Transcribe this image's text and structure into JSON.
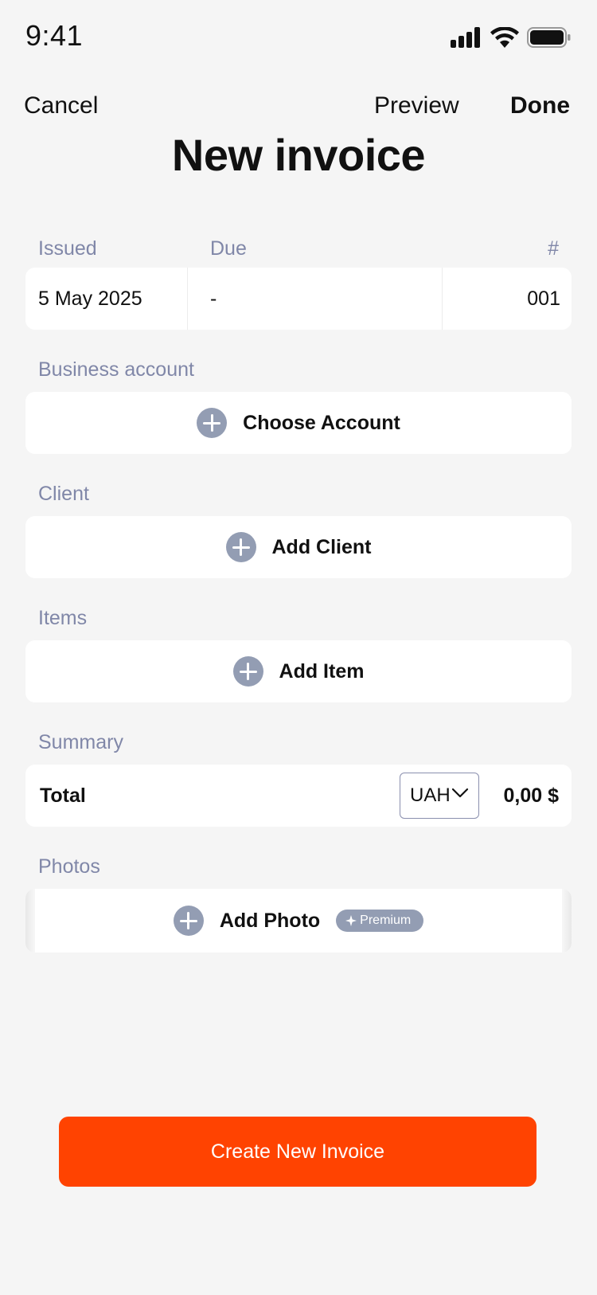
{
  "status_bar": {
    "time": "9:41"
  },
  "nav": {
    "cancel": "Cancel",
    "preview": "Preview",
    "done": "Done"
  },
  "title": "New invoice",
  "meta": {
    "issued_label": "Issued",
    "due_label": "Due",
    "number_label": "#",
    "issued_value": "5 May 2025",
    "due_value": "-",
    "number_value": "001"
  },
  "business": {
    "label": "Business account",
    "action": "Choose Account"
  },
  "client": {
    "label": "Client",
    "action": "Add Client"
  },
  "items": {
    "label": "Items",
    "action": "Add Item"
  },
  "summary": {
    "label": "Summary",
    "total_label": "Total",
    "currency": "UAH",
    "total_value": "0,00 $"
  },
  "photos": {
    "label": "Photos",
    "action": "Add Photo",
    "badge": "Premium"
  },
  "create_button": "Create New Invoice",
  "colors": {
    "accent": "#ff4301",
    "label": "#8087a8",
    "icon": "#939db3",
    "background": "#f5f5f5"
  }
}
